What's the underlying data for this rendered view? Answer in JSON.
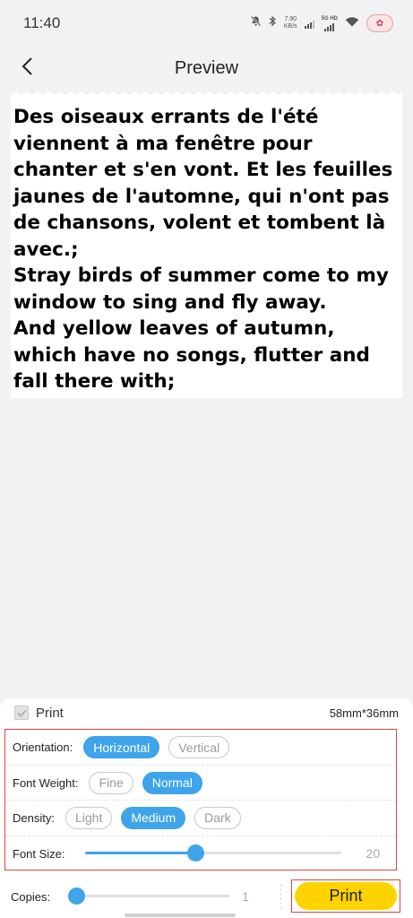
{
  "status_bar": {
    "time": "11:40",
    "net_speed_value": "7.90",
    "net_speed_unit": "KB/s",
    "network_type": "5G HD",
    "icons": [
      "mute-bell-icon",
      "bluetooth-icon",
      "signal-icon",
      "wifi-icon",
      "avatar-icon"
    ]
  },
  "header": {
    "title": "Preview",
    "back_icon": "chevron-left-icon"
  },
  "preview": {
    "text": "Des oiseaux errants de l'été viennent à ma fenêtre pour chanter et s'en vont. Et les feuilles jaunes de l'automne, qui n'ont pas de chansons, volent et tombent là avec.;\nStray birds of summer come to my window to sing and fly away.\nAnd yellow leaves of autumn, which have no songs, flutter and fall there with;"
  },
  "panel": {
    "print_checkbox_label": "Print",
    "print_checked": true,
    "label_size": "58mm*36mm",
    "orientation": {
      "label": "Orientation:",
      "options": [
        "Horizontal",
        "Vertical"
      ],
      "selected": "Horizontal"
    },
    "font_weight": {
      "label": "Font Weight:",
      "options": [
        "Fine",
        "Normal"
      ],
      "selected": "Normal"
    },
    "density": {
      "label": "Density:",
      "options": [
        "Light",
        "Medium",
        "Dark"
      ],
      "selected": "Medium"
    },
    "font_size": {
      "label": "Font Size:",
      "value": "20",
      "fraction": 0.43
    },
    "copies": {
      "label": "Copies:",
      "value": "1",
      "fraction": 0.0
    },
    "print_button": "Print"
  },
  "colors": {
    "accent": "#3fa4ea",
    "print_button": "#ffd300",
    "highlight_border": "#e0443c"
  }
}
